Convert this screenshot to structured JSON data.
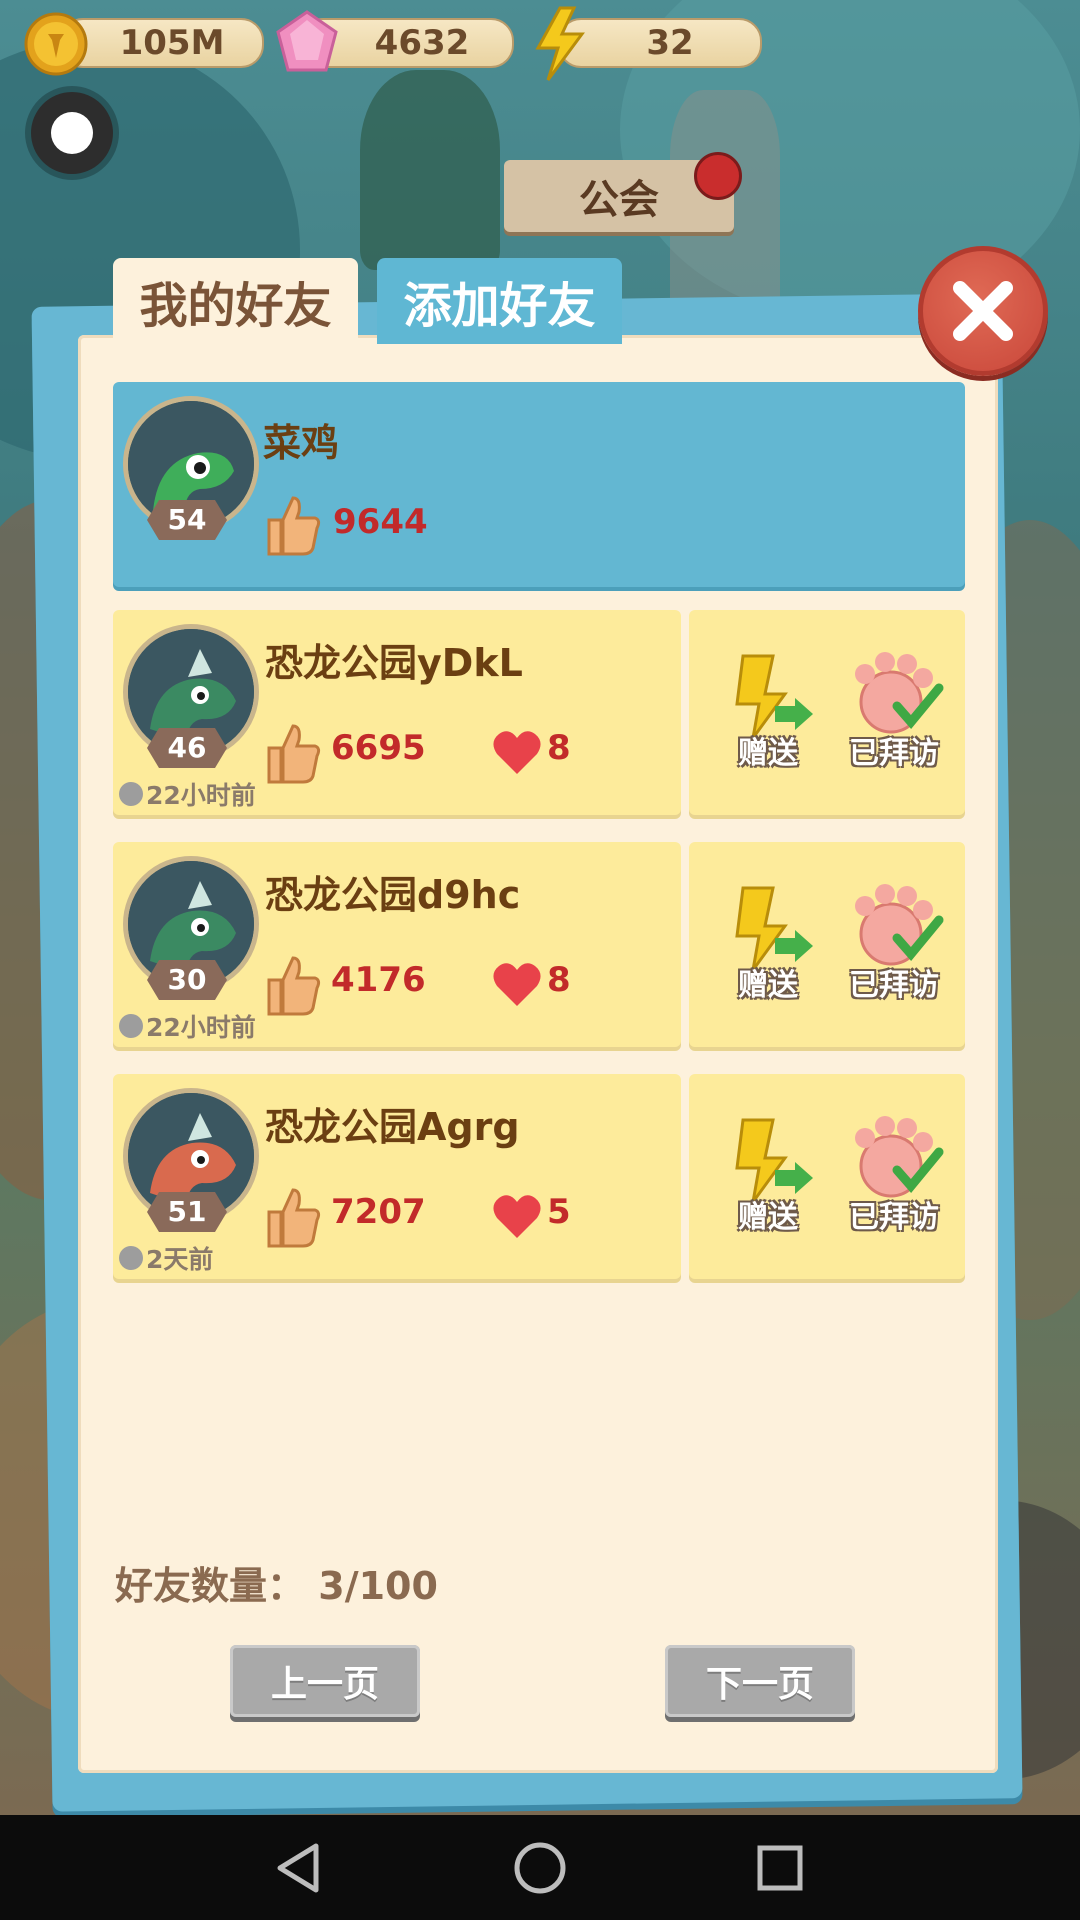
{
  "currency": {
    "coins": "105M",
    "gems": "4632",
    "energy": "32"
  },
  "background": {
    "guild_label": "公会"
  },
  "tabs": {
    "my_friends": "我的好友",
    "add_friend": "添加好友"
  },
  "self": {
    "name": "菜鸡",
    "level": "54",
    "likes": "9644"
  },
  "friends": [
    {
      "name": "恐龙公园yDkL",
      "level": "46",
      "last_online": "22小时前",
      "likes": "6695",
      "hearts": "8",
      "gift_label": "赠送",
      "visited_label": "已拜访",
      "avatar_color": "#3b8a62"
    },
    {
      "name": "恐龙公园d9hc",
      "level": "30",
      "last_online": "22小时前",
      "likes": "4176",
      "hearts": "8",
      "gift_label": "赠送",
      "visited_label": "已拜访",
      "avatar_color": "#3b8a62"
    },
    {
      "name": "恐龙公园Agrg",
      "level": "51",
      "last_online": "2天前",
      "likes": "7207",
      "hearts": "5",
      "gift_label": "赠送",
      "visited_label": "已拜访",
      "avatar_color": "#d96a4e"
    }
  ],
  "footer": {
    "count_label": "好友数量：",
    "count_value": "3/100",
    "prev_label": "上一页",
    "next_label": "下一页"
  },
  "colors": {
    "self_row": "#63b7d2",
    "friend_row": "#fdeb9b",
    "accent_red": "#c22a2a",
    "close_button": "#c9473a"
  },
  "icons": [
    "coin-icon",
    "gem-icon",
    "lightning-icon",
    "thumbs-up-icon",
    "heart-icon",
    "gift-lightning-icon",
    "visited-paw-icon",
    "close-icon",
    "back-nav-icon",
    "home-nav-icon",
    "recent-nav-icon"
  ]
}
